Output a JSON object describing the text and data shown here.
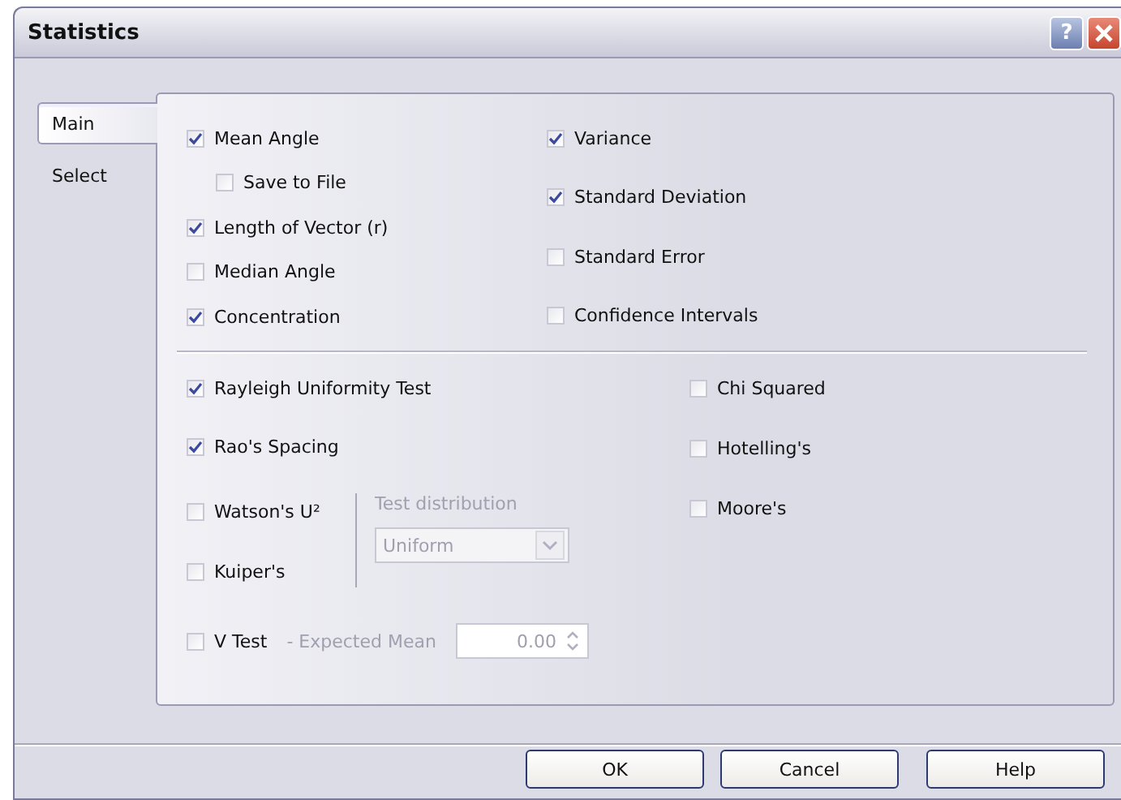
{
  "window": {
    "title": "Statistics",
    "help_button": "?"
  },
  "tabs": [
    {
      "label": "Main",
      "selected": true
    },
    {
      "label": "Select",
      "selected": false
    }
  ],
  "summary": {
    "left": [
      {
        "label": "Mean Angle",
        "checked": true,
        "children": [
          {
            "label": "Save to File",
            "checked": false
          }
        ]
      },
      {
        "label": "Length of Vector (r)",
        "checked": true
      },
      {
        "label": "Median Angle",
        "checked": false
      },
      {
        "label": "Concentration",
        "checked": true
      }
    ],
    "right": [
      {
        "label": "Variance",
        "checked": true
      },
      {
        "label": "Standard Deviation",
        "checked": true
      },
      {
        "label": "Standard Error",
        "checked": false
      },
      {
        "label": "Confidence Intervals",
        "checked": false
      }
    ]
  },
  "tests": {
    "top": [
      {
        "label": "Rayleigh Uniformity Test",
        "checked": true
      },
      {
        "label": "Rao's Spacing",
        "checked": true
      }
    ],
    "distribution_tests": [
      {
        "label": "Watson's U²",
        "checked": false
      },
      {
        "label": "Kuiper's",
        "checked": false
      }
    ],
    "test_distribution": {
      "label": "Test distribution",
      "value": "Uniform",
      "disabled": true
    },
    "v_test": {
      "label": "V Test",
      "checked": false,
      "expected_mean_label": "- Expected Mean",
      "expected_mean": "0.00",
      "disabled": true
    },
    "right": [
      {
        "label": "Chi Squared",
        "checked": false
      },
      {
        "label": "Hotelling's",
        "checked": false
      },
      {
        "label": "Moore's",
        "checked": false
      }
    ]
  },
  "buttons": [
    "OK",
    "Cancel",
    "Help"
  ]
}
